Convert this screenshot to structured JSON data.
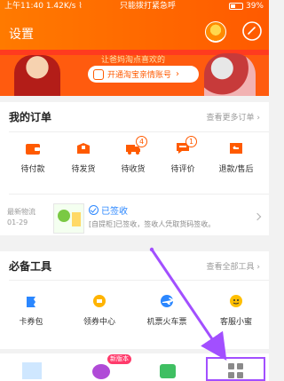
{
  "status_bar": {
    "time": "上午11:40",
    "speed": "1.42K/s",
    "center": "只能拨打紧急呼",
    "battery": "39%"
  },
  "header": {
    "title": "设置"
  },
  "banner": {
    "subtitle": "让爸妈淘点喜欢的",
    "cta_label": "开通淘宝亲情账号"
  },
  "orders": {
    "title": "我的订单",
    "more_label": "查看更多订单",
    "items": [
      {
        "label": "待付款"
      },
      {
        "label": "待发货"
      },
      {
        "label": "待收货",
        "badge": "4"
      },
      {
        "label": "待评价",
        "badge": "1"
      },
      {
        "label": "退款/售后"
      }
    ],
    "logistics": {
      "tag": "最新物流",
      "date": "01-29",
      "status": "已签收",
      "detail": "[自提柜]已签收，签收人凭取货码签收。"
    }
  },
  "tools": {
    "title": "必备工具",
    "more_label": "查看全部工具",
    "items": [
      {
        "label": "卡券包"
      },
      {
        "label": "领券中心"
      },
      {
        "label": "机票火车票"
      },
      {
        "label": "客服小蜜"
      }
    ]
  },
  "bottom_nav": {
    "badge": "新版本"
  },
  "colors": {
    "orange": "#ff5a00",
    "blue": "#2b87ff",
    "purple_annotation": "#a24fff"
  }
}
